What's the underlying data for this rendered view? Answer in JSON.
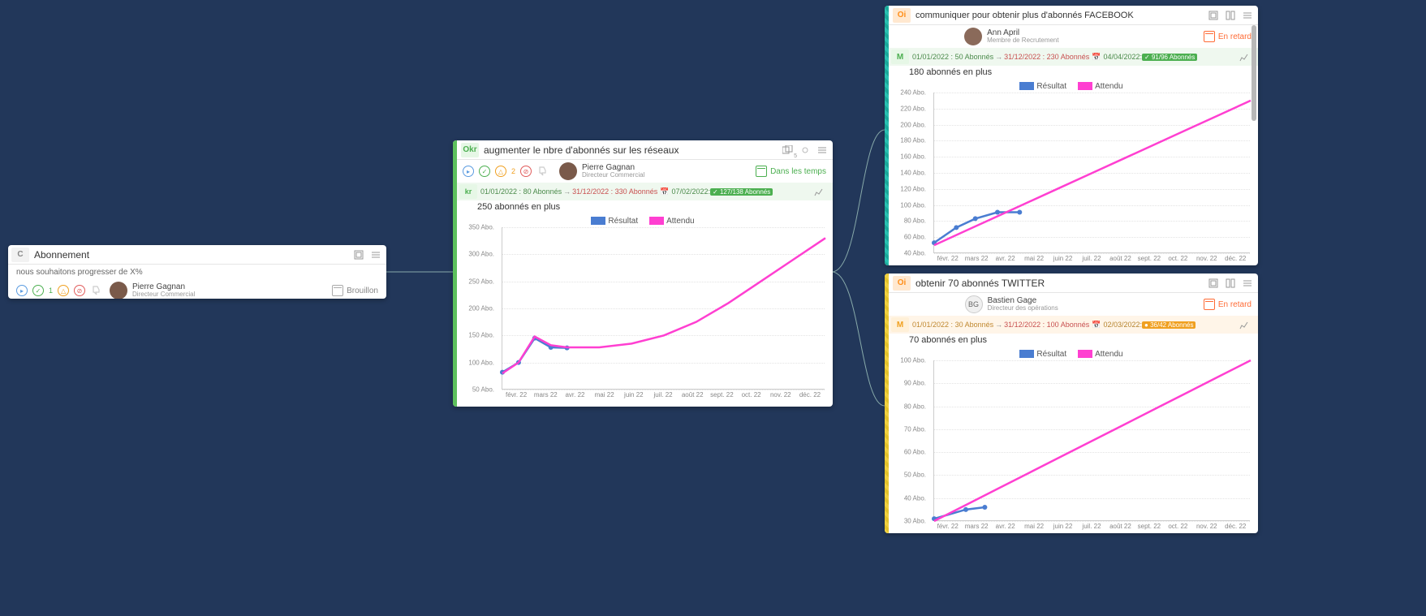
{
  "colors": {
    "blue": "#4a7dd1",
    "pink": "#ff3fd1"
  },
  "legend": {
    "result": "Résultat",
    "expected": "Attendu"
  },
  "months": [
    "févr. 22",
    "mars 22",
    "avr. 22",
    "mai 22",
    "juin 22",
    "juil. 22",
    "août 22",
    "sept. 22",
    "oct. 22",
    "nov. 22",
    "déc. 22"
  ],
  "cardC": {
    "tag": "C",
    "title": "Abonnement",
    "description": "nous souhaitons progresser de X%",
    "owner": {
      "name": "Pierre Gagnan",
      "role": "Directeur Commercial"
    },
    "draft": "Brouillon",
    "mini": {
      "green_count": "1"
    }
  },
  "okr": {
    "tag": "Okr",
    "title": "augmenter le nbre d'abonnés sur les réseaux",
    "owner": {
      "name": "Pierre Gagnan",
      "role": "Directeur Commercial"
    },
    "status": "Dans les temps",
    "mini": {
      "orange_count": "2"
    },
    "children_badge": "5",
    "kr": {
      "tag": "kr",
      "start": {
        "date": "01/01/2022",
        "value": "80 Abonnés"
      },
      "end": {
        "date": "31/12/2022",
        "value": "330 Abonnés"
      },
      "lastupdate": "07/02/2022",
      "progress": "127/138 Abonnés",
      "title": "250 abonnés en plus"
    },
    "chart_data": {
      "type": "line",
      "xlabel": "",
      "ylabel": "",
      "x_categories": [
        "févr. 22",
        "mars 22",
        "avr. 22",
        "mai 22",
        "juin 22",
        "juil. 22",
        "août 22",
        "sept. 22",
        "oct. 22",
        "nov. 22",
        "déc. 22"
      ],
      "yticks": [
        "50 Abo.",
        "100 Abo.",
        "150 Abo.",
        "200 Abo.",
        "250 Abo.",
        "300 Abo.",
        "350 Abo."
      ],
      "ylim": [
        50,
        350
      ],
      "series": [
        {
          "name": "Résultat",
          "color": "blue",
          "points": [
            {
              "x": 0,
              "y": 82
            },
            {
              "x": 0.5,
              "y": 100
            },
            {
              "x": 1,
              "y": 145
            },
            {
              "x": 1.5,
              "y": 128
            },
            {
              "x": 2,
              "y": 127
            }
          ]
        },
        {
          "name": "Attendu",
          "color": "pink",
          "points": [
            {
              "x": 0,
              "y": 80
            },
            {
              "x": 0.5,
              "y": 100
            },
            {
              "x": 1,
              "y": 148
            },
            {
              "x": 1.5,
              "y": 132
            },
            {
              "x": 2,
              "y": 128
            },
            {
              "x": 3,
              "y": 128
            },
            {
              "x": 4,
              "y": 135
            },
            {
              "x": 5,
              "y": 150
            },
            {
              "x": 6,
              "y": 175
            },
            {
              "x": 7,
              "y": 210
            },
            {
              "x": 8,
              "y": 250
            },
            {
              "x": 9,
              "y": 290
            },
            {
              "x": 10,
              "y": 330
            }
          ]
        }
      ]
    }
  },
  "facebook": {
    "tag": "Oi",
    "title": "communiquer pour obtenir plus d'abonnés FACEBOOK",
    "owner": {
      "name": "Ann April",
      "role": "Membre de Recrutement"
    },
    "status": "En retard",
    "m": {
      "tag": "M",
      "start": {
        "date": "01/01/2022",
        "value": "50 Abonnés"
      },
      "end": {
        "date": "31/12/2022",
        "value": "230 Abonnés"
      },
      "lastupdate": "04/04/2022",
      "progress": "91/96 Abonnés",
      "title": "180 abonnés en plus"
    },
    "chart_data": {
      "type": "line",
      "x_categories": [
        "févr. 22",
        "mars 22",
        "avr. 22",
        "mai 22",
        "juin 22",
        "juil. 22",
        "août 22",
        "sept. 22",
        "oct. 22",
        "nov. 22",
        "déc. 22"
      ],
      "yticks": [
        "40 Abo.",
        "60 Abo.",
        "80 Abo.",
        "100 Abo.",
        "120 Abo.",
        "140 Abo.",
        "160 Abo.",
        "180 Abo.",
        "200 Abo.",
        "220 Abo.",
        "240 Abo."
      ],
      "ylim": [
        40,
        240
      ],
      "series": [
        {
          "name": "Résultat",
          "color": "blue",
          "points": [
            {
              "x": 0,
              "y": 53
            },
            {
              "x": 0.7,
              "y": 72
            },
            {
              "x": 1.3,
              "y": 83
            },
            {
              "x": 2,
              "y": 91
            },
            {
              "x": 2.7,
              "y": 91
            }
          ]
        },
        {
          "name": "Attendu",
          "color": "pink",
          "points": [
            {
              "x": 0,
              "y": 50
            },
            {
              "x": 1,
              "y": 68
            },
            {
              "x": 2,
              "y": 86
            },
            {
              "x": 3,
              "y": 104
            },
            {
              "x": 4,
              "y": 122
            },
            {
              "x": 5,
              "y": 140
            },
            {
              "x": 6,
              "y": 158
            },
            {
              "x": 7,
              "y": 176
            },
            {
              "x": 8,
              "y": 194
            },
            {
              "x": 9,
              "y": 212
            },
            {
              "x": 10,
              "y": 230
            }
          ]
        }
      ]
    }
  },
  "twitter": {
    "tag": "Oi",
    "title": "obtenir 70 abonnés TWITTER",
    "owner": {
      "initials": "BG",
      "name": "Bastien Gage",
      "role": "Directeur des opérations"
    },
    "status": "En retard",
    "m": {
      "tag": "M",
      "start": {
        "date": "01/01/2022",
        "value": "30 Abonnés"
      },
      "end": {
        "date": "31/12/2022",
        "value": "100 Abonnés"
      },
      "lastupdate": "02/03/2022",
      "progress": "36/42 Abonnés",
      "title": "70 abonnés en plus"
    },
    "chart_data": {
      "type": "line",
      "x_categories": [
        "févr. 22",
        "mars 22",
        "avr. 22",
        "mai 22",
        "juin 22",
        "juil. 22",
        "août 22",
        "sept. 22",
        "oct. 22",
        "nov. 22",
        "déc. 22"
      ],
      "yticks": [
        "30 Abo.",
        "40 Abo.",
        "50 Abo.",
        "60 Abo.",
        "70 Abo.",
        "80 Abo.",
        "90 Abo.",
        "100 Abo."
      ],
      "ylim": [
        30,
        100
      ],
      "series": [
        {
          "name": "Résultat",
          "color": "blue",
          "points": [
            {
              "x": 0,
              "y": 31
            },
            {
              "x": 1,
              "y": 35
            },
            {
              "x": 1.6,
              "y": 36
            }
          ]
        },
        {
          "name": "Attendu",
          "color": "pink",
          "points": [
            {
              "x": 0,
              "y": 30
            },
            {
              "x": 1,
              "y": 37
            },
            {
              "x": 2,
              "y": 44
            },
            {
              "x": 3,
              "y": 51
            },
            {
              "x": 4,
              "y": 58
            },
            {
              "x": 5,
              "y": 65
            },
            {
              "x": 6,
              "y": 72
            },
            {
              "x": 7,
              "y": 79
            },
            {
              "x": 8,
              "y": 86
            },
            {
              "x": 9,
              "y": 93
            },
            {
              "x": 10,
              "y": 100
            }
          ]
        }
      ]
    }
  }
}
